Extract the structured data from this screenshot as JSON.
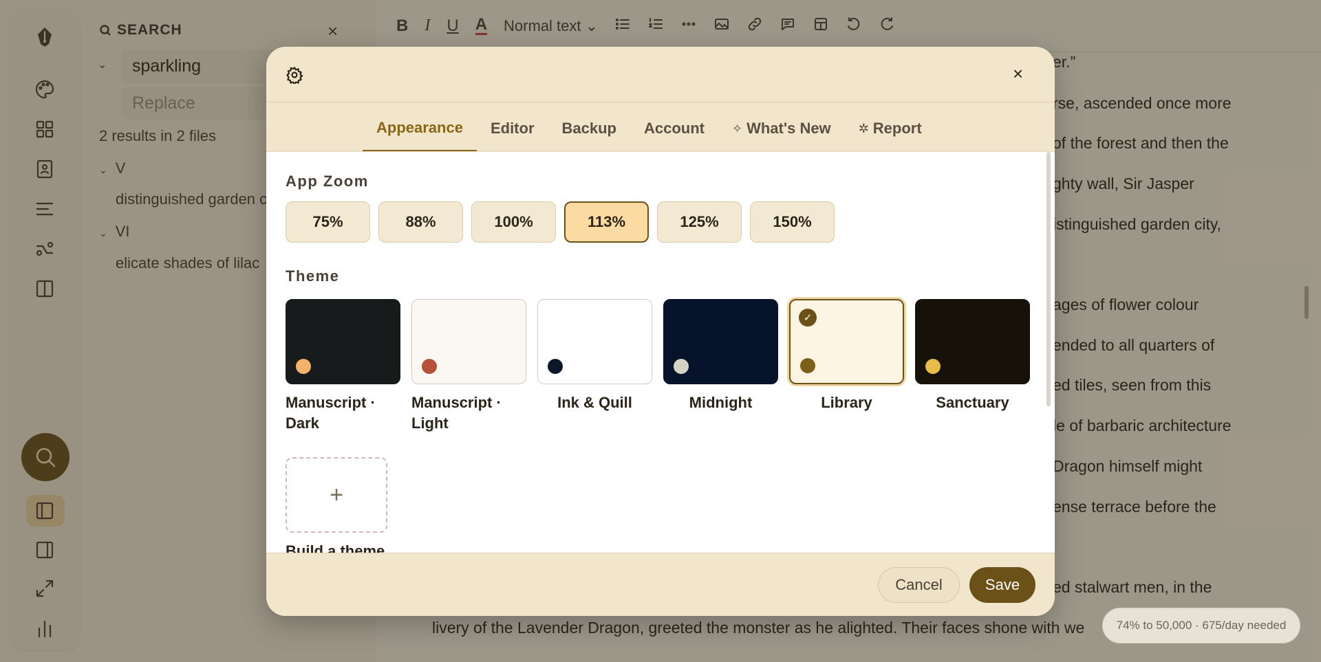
{
  "search_panel": {
    "title": "SEARCH",
    "query": "sparkling",
    "replace_placeholder": "Replace",
    "results_summary": "2 results in 2 files",
    "groups": [
      {
        "name": "V",
        "match": "distinguished garden city,"
      },
      {
        "name": "VI",
        "match": "elicate shades of lilac"
      }
    ]
  },
  "toolbar": {
    "bold": "B",
    "italic": "I",
    "underline": "U",
    "text_color": "A",
    "style_select": "Normal text",
    "style_chevron": "⌄"
  },
  "editor_lines": [
    "er.”",
    "rse, ascended once more",
    "of the forest and then the",
    "ghty wall, Sir Jasper",
    "istinguished garden city,",
    "ages of flower colour",
    "ended to all quarters of",
    "ed tiles, seen from this",
    "le of barbaric architecture",
    "Dragon himself might",
    "ense terrace before the",
    "ed stalwart men, in the"
  ],
  "editor_bottom_line": "livery of the Lavender Dragon, greeted the monster as he alighted. Their faces shone with we",
  "stats": "74% to 50,000 · 675/day needed",
  "modal": {
    "tabs": [
      {
        "label": "Appearance",
        "glyph": ""
      },
      {
        "label": "Editor",
        "glyph": ""
      },
      {
        "label": "Backup",
        "glyph": ""
      },
      {
        "label": "Account",
        "glyph": ""
      },
      {
        "label": "What's New",
        "glyph": "✧"
      },
      {
        "label": "Report",
        "glyph": "✲"
      }
    ],
    "active_tab": "Appearance",
    "app_zoom": {
      "title": "App Zoom",
      "options": [
        "75%",
        "88%",
        "100%",
        "113%",
        "125%",
        "150%"
      ],
      "selected": "113%"
    },
    "theme": {
      "title": "Theme",
      "options": [
        {
          "name": "Manuscript · Dark",
          "bg": "#181b1c",
          "dot": "#f6b26b",
          "border": "#181b1c"
        },
        {
          "name": "Manuscript · Light",
          "bg": "#fbf8f3",
          "dot": "#b5503a",
          "border": "#dcc7c7"
        },
        {
          "name": "Ink & Quill",
          "bg": "#ffffff",
          "dot": "#0c1729",
          "border": "#dcc7c7"
        },
        {
          "name": "Midnight",
          "bg": "#06132b",
          "dot": "#d6d2c6",
          "border": "#06132b"
        },
        {
          "name": "Library",
          "bg": "#fdf4e3",
          "dot": "#7c5f18",
          "border": "#6b5118"
        },
        {
          "name": "Sanctuary",
          "bg": "#161209",
          "dot": "#e8bd45",
          "border": "#161209"
        }
      ],
      "selected": "Library",
      "check_glyph": "✓",
      "build_label": "Build a theme",
      "build_glyph": "+"
    },
    "close_glyph": "×",
    "cancel_label": "Cancel",
    "save_label": "Save"
  },
  "colors": {
    "accent": "#6b5118",
    "tab_active": "#8a6517",
    "zoom_selected_bg": "#fbdba2"
  }
}
